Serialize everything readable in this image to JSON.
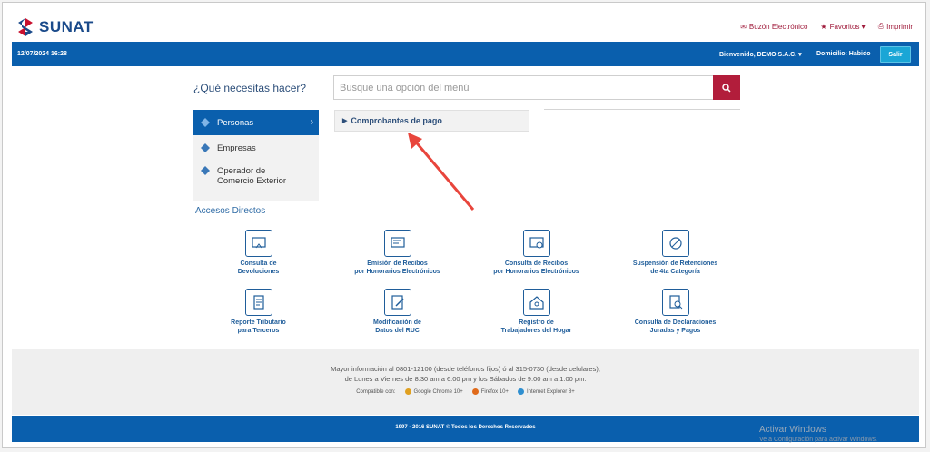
{
  "header": {
    "logo_text": "SUNAT",
    "links": [
      {
        "label": "Buzón Electrónico",
        "icon": "envelope-icon"
      },
      {
        "label": "Favoritos ▾",
        "icon": "star-icon"
      },
      {
        "label": "Imprimir",
        "icon": "printer-icon"
      }
    ]
  },
  "bluebar": {
    "datetime": "12/07/2024 16:28",
    "welcome": "Bienvenido, DEMO S.A.C. ▾",
    "domicilio": "Domicilio: Habido",
    "salir": "Salir"
  },
  "main": {
    "question": "¿Qué necesitas hacer?",
    "search_placeholder": "Busque una opción del menú",
    "menu": [
      {
        "label": "Personas"
      },
      {
        "label": "Empresas"
      },
      {
        "label": "Operador de\nComercio Exterior"
      }
    ],
    "submenu_item": "Comprobantes de pago",
    "accesos_title": "Accesos Directos",
    "tiles": [
      {
        "label": "Consulta de\nDevoluciones",
        "icon": "devoluciones-icon"
      },
      {
        "label": "Emisión de Recibos\npor Honorarios Electrónicos",
        "icon": "emision-recibos-icon"
      },
      {
        "label": "Consulta de Recibos\npor Honorarios Electrónicos",
        "icon": "consulta-recibos-icon"
      },
      {
        "label": "Suspensión de Retenciones\nde 4ta Categoría",
        "icon": "suspension-icon"
      },
      {
        "label": "Reporte Tributario\npara Terceros",
        "icon": "report-icon"
      },
      {
        "label": "Modificación de\nDatos del RUC",
        "icon": "edit-doc-icon"
      },
      {
        "label": "Registro de\nTrabajadores del Hogar",
        "icon": "home-icon"
      },
      {
        "label": "Consulta de Declaraciones\nJuradas y Pagos",
        "icon": "search-doc-icon"
      }
    ]
  },
  "footer": {
    "info_line1": "Mayor información al 0801-12100 (desde teléfonos fijos) ó al 315-0730 (desde celulares),",
    "info_line2": "de Lunes a Viernes de 8:30 am a 6:00 pm y los Sábados de 9:00 am a 1:00 pm.",
    "compat_label": "Compatible con:",
    "browsers": [
      {
        "label": "Google Chrome 10+",
        "color": "#e0a020"
      },
      {
        "label": "Firefox 10+",
        "color": "#e06a1a"
      },
      {
        "label": "Internet Explorer 8+",
        "color": "#2f8fd0"
      }
    ],
    "copyright": "1997 - 2016 SUNAT © Todos los Derechos Reservados"
  },
  "watermark": {
    "line1": "Activar Windows",
    "line2": "Ve a Configuración para activar Windows."
  }
}
